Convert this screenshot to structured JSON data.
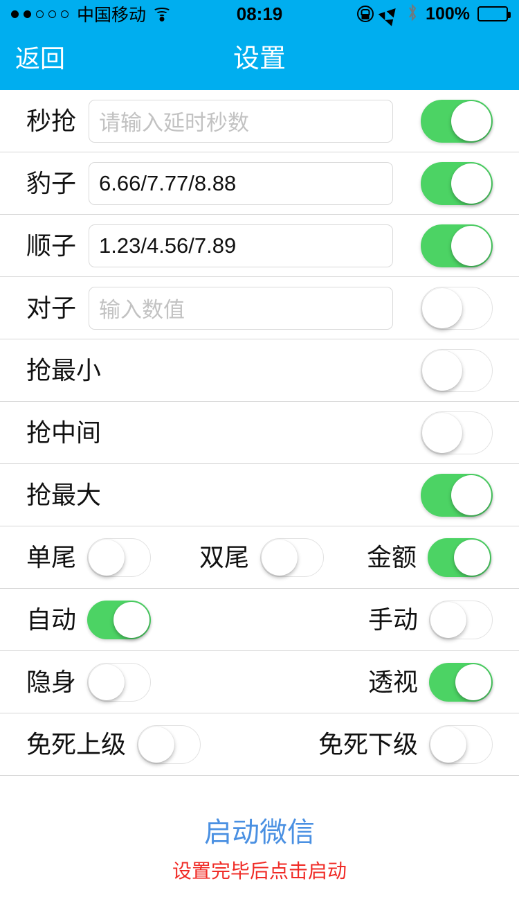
{
  "status_bar": {
    "signal_dots_filled": 2,
    "signal_dots_total": 5,
    "carrier": "中国移动",
    "wifi_icon": "wifi-icon",
    "time": "08:19",
    "rotation_lock_icon": "rotation-lock-icon",
    "location_icon": "location-arrow-icon",
    "bluetooth_icon": "bluetooth-icon",
    "battery_percent": "100%",
    "battery_icon": "battery-full-icon",
    "background_color": "#00AEEF"
  },
  "nav_bar": {
    "back_label": "返回",
    "title": "设置",
    "background_color": "#00AEEF",
    "text_color": "#FFFFFF"
  },
  "colors": {
    "toggle_on": "#4CD364",
    "toggle_off_track": "#FFFFFF",
    "link_blue": "#4A90E2",
    "hint_red": "#F02B26",
    "divider": "#D6D6D6"
  },
  "rows": [
    {
      "type": "field",
      "label": "秒抢",
      "value": "",
      "placeholder": "请输入延时秒数",
      "toggle_on": true
    },
    {
      "type": "field",
      "label": "豹子",
      "value": "6.66/7.77/8.88",
      "placeholder": "",
      "toggle_on": true
    },
    {
      "type": "field",
      "label": "顺子",
      "value": "1.23/4.56/7.89",
      "placeholder": "",
      "toggle_on": true
    },
    {
      "type": "field",
      "label": "对子",
      "value": "",
      "placeholder": "输入数值",
      "toggle_on": false
    },
    {
      "type": "simple",
      "label": "抢最小",
      "toggle_on": false
    },
    {
      "type": "simple",
      "label": "抢中间",
      "toggle_on": false
    },
    {
      "type": "simple",
      "label": "抢最大",
      "toggle_on": true
    }
  ],
  "multi_rows": [
    {
      "cells": [
        {
          "label": "单尾",
          "toggle_on": false
        },
        {
          "label": "双尾",
          "toggle_on": false
        },
        {
          "label": "金额",
          "toggle_on": true
        }
      ]
    },
    {
      "cells": [
        {
          "label": "自动",
          "toggle_on": true
        },
        {
          "label": "手动",
          "toggle_on": false
        }
      ]
    },
    {
      "cells": [
        {
          "label": "隐身",
          "toggle_on": false
        },
        {
          "label": "透视",
          "toggle_on": true
        }
      ]
    },
    {
      "cells": [
        {
          "label": "免死上级",
          "toggle_on": false
        },
        {
          "label": "免死下级",
          "toggle_on": false
        }
      ]
    }
  ],
  "footer": {
    "launch_label": "启动微信",
    "hint": "设置完毕后点击启动"
  }
}
